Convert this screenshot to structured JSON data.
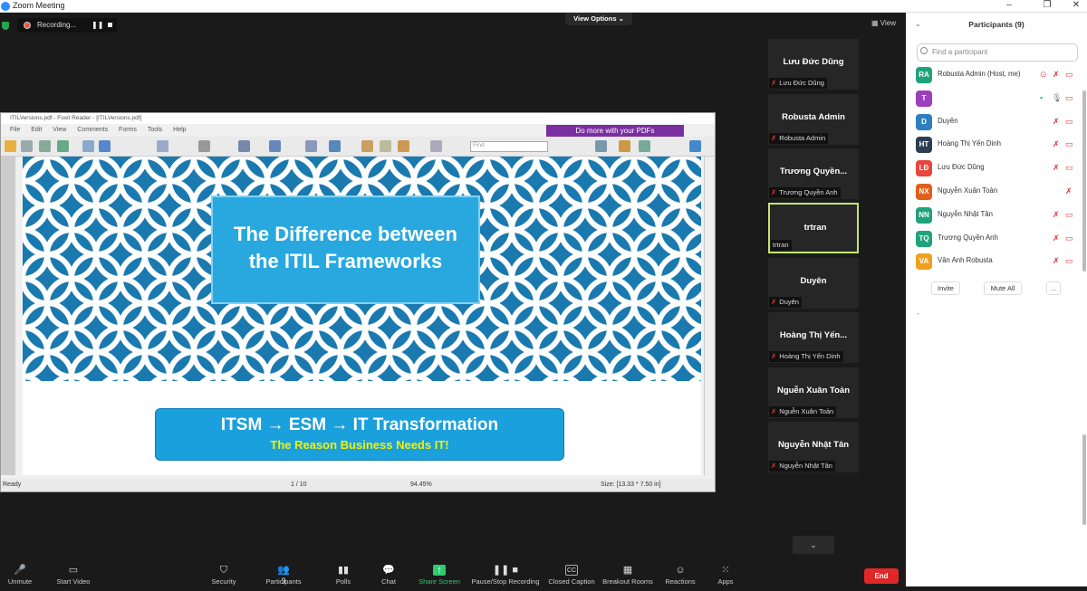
{
  "window": {
    "title": "Zoom Meeting"
  },
  "top": {
    "view_options": "View Options ⌄",
    "view": "View"
  },
  "recording": {
    "label": "Recording...",
    "pause": "❚❚"
  },
  "foxit": {
    "title": "ITILVersions.pdf - Foxit Reader - [ITILVersions.pdf]",
    "menus": [
      "File",
      "Edit",
      "View",
      "Comments",
      "Forms",
      "Tools",
      "Help"
    ],
    "ad": "Do more with your PDFs",
    "find_placeholder": "Find",
    "status": {
      "ready": "Ready",
      "page": "1 / 10",
      "zoom": "94.45%",
      "size": "Size: [13.33 * 7.50 in]"
    }
  },
  "slide": {
    "title_line1": "The Difference between",
    "title_line2": "the ITIL Frameworks",
    "box_line1": "ITSM → ESM → IT Transformation",
    "box_line2": "The Reason Business Needs IT!"
  },
  "tiles": [
    {
      "name": "Lưu Đức Dũng",
      "label": "Lưu Đức Dũng",
      "muted": true
    },
    {
      "name": "Robusta Admin",
      "label": "Robusta Admin",
      "muted": true
    },
    {
      "name": "Trương  Quyền...",
      "label": "Trương Quyền Anh",
      "muted": true
    },
    {
      "name": "trtran",
      "label": "trtran",
      "muted": false,
      "active": true
    },
    {
      "name": "Duyên",
      "label": "Duyên",
      "muted": true
    },
    {
      "name": "Hoàng  Thị  Yến...",
      "label": "Hoàng Thị Yến Dinh",
      "muted": true
    },
    {
      "name": "Nguễn Xuân Toản",
      "label": "Nguễn Xuân Toản",
      "muted": true
    },
    {
      "name": "Nguyễn Nhật Tân",
      "label": "Nguyễn Nhật Tân",
      "muted": true
    }
  ],
  "more_label": "⌄",
  "toolbar": {
    "unmute": "Unmute",
    "start_video": "Start Video",
    "security": "Security",
    "participants": "Participants",
    "participants_count": "9",
    "polls": "Polls",
    "chat": "Chat",
    "share_screen": "Share Screen",
    "recording": "Pause/Stop Recording",
    "closed_caption": "Closed Caption",
    "breakout": "Breakout Rooms",
    "reactions": "Reactions",
    "apps": "Apps",
    "end": "End",
    "cc_icon": "CC"
  },
  "panel": {
    "header": "Participants (9)",
    "search_placeholder": "Find a participant",
    "people": [
      {
        "initials": "RA",
        "name": "Robusta Admin (Host, me)",
        "color": "#1fa37a"
      },
      {
        "initials": "T",
        "name": "",
        "color": "#9b3fbf"
      },
      {
        "initials": "D",
        "name": "Duyên",
        "color": "#2f7fbf"
      },
      {
        "initials": "HT",
        "name": "Hoàng Thị Yến Dinh",
        "color": "#2c3e50"
      },
      {
        "initials": "LĐ",
        "name": "Lưu Đức Dũng",
        "color": "#e8453c"
      },
      {
        "initials": "NX",
        "name": "Nguyễn Xuân Toản",
        "color": "#e0601a"
      },
      {
        "initials": "NN",
        "name": "Nguyễn Nhật Tân",
        "color": "#1fa37a"
      },
      {
        "initials": "TQ",
        "name": "Trương Quyền Anh",
        "color": "#1fa37a"
      },
      {
        "initials": "VA",
        "name": "Vân Anh Robusta",
        "color": "#f0a020"
      }
    ],
    "invite": "Invite",
    "mute_all": "Mute All",
    "more": "...",
    "dash": "-"
  }
}
